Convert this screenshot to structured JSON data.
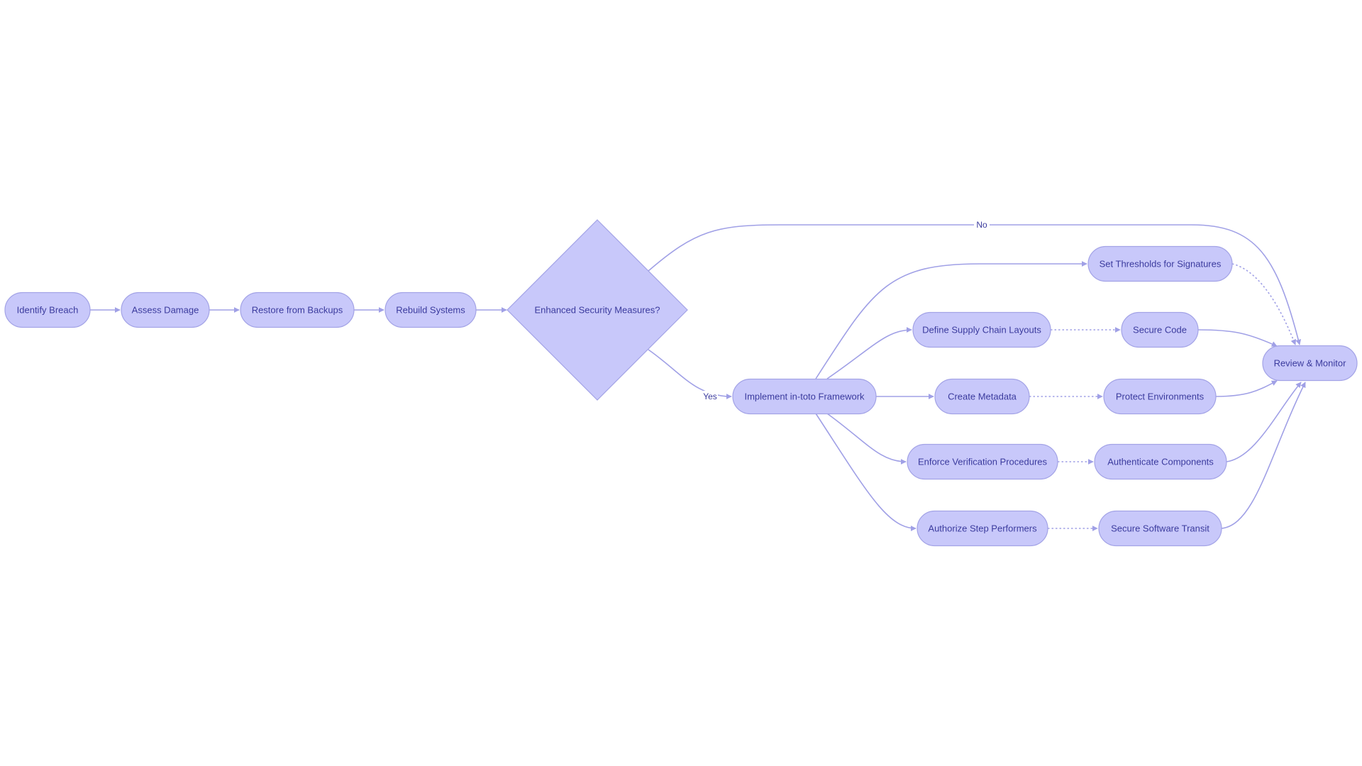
{
  "diagram": {
    "type": "flowchart",
    "direction": "LR",
    "colors": {
      "node_fill": "#c8c8fa",
      "node_stroke": "#a3a3e6",
      "node_text": "#3b3b9e",
      "edge": "#a0a0e6"
    },
    "nodes": [
      {
        "id": "identify",
        "label": "Identify Breach",
        "shape": "stadium"
      },
      {
        "id": "assess",
        "label": "Assess Damage",
        "shape": "stadium"
      },
      {
        "id": "restore",
        "label": "Restore from Backups",
        "shape": "stadium"
      },
      {
        "id": "rebuild",
        "label": "Rebuild Systems",
        "shape": "stadium"
      },
      {
        "id": "decision",
        "label": "Enhanced Security Measures?",
        "shape": "diamond"
      },
      {
        "id": "implement",
        "label": "Implement in-toto Framework",
        "shape": "stadium"
      },
      {
        "id": "thresholds",
        "label": "Set Thresholds for Signatures",
        "shape": "stadium"
      },
      {
        "id": "define",
        "label": "Define Supply Chain Layouts",
        "shape": "stadium"
      },
      {
        "id": "metadata",
        "label": "Create Metadata",
        "shape": "stadium"
      },
      {
        "id": "enforce",
        "label": "Enforce Verification Procedures",
        "shape": "stadium"
      },
      {
        "id": "authorize",
        "label": "Authorize Step Performers",
        "shape": "stadium"
      },
      {
        "id": "securecode",
        "label": "Secure Code",
        "shape": "stadium"
      },
      {
        "id": "protect",
        "label": "Protect Environments",
        "shape": "stadium"
      },
      {
        "id": "authenticate",
        "label": "Authenticate Components",
        "shape": "stadium"
      },
      {
        "id": "transit",
        "label": "Secure Software Transit",
        "shape": "stadium"
      },
      {
        "id": "review",
        "label": "Review & Monitor",
        "shape": "stadium"
      }
    ],
    "edges": [
      {
        "from": "identify",
        "to": "assess",
        "style": "solid",
        "label": ""
      },
      {
        "from": "assess",
        "to": "restore",
        "style": "solid",
        "label": ""
      },
      {
        "from": "restore",
        "to": "rebuild",
        "style": "solid",
        "label": ""
      },
      {
        "from": "rebuild",
        "to": "decision",
        "style": "solid",
        "label": ""
      },
      {
        "from": "decision",
        "to": "implement",
        "style": "solid",
        "label": "Yes"
      },
      {
        "from": "decision",
        "to": "review",
        "style": "solid",
        "label": "No"
      },
      {
        "from": "implement",
        "to": "thresholds",
        "style": "solid",
        "label": ""
      },
      {
        "from": "implement",
        "to": "define",
        "style": "solid",
        "label": ""
      },
      {
        "from": "implement",
        "to": "metadata",
        "style": "solid",
        "label": ""
      },
      {
        "from": "implement",
        "to": "enforce",
        "style": "solid",
        "label": ""
      },
      {
        "from": "implement",
        "to": "authorize",
        "style": "solid",
        "label": ""
      },
      {
        "from": "define",
        "to": "securecode",
        "style": "dotted",
        "label": ""
      },
      {
        "from": "metadata",
        "to": "protect",
        "style": "dotted",
        "label": ""
      },
      {
        "from": "enforce",
        "to": "authenticate",
        "style": "dotted",
        "label": ""
      },
      {
        "from": "authorize",
        "to": "transit",
        "style": "dotted",
        "label": ""
      },
      {
        "from": "thresholds",
        "to": "review",
        "style": "dotted",
        "label": ""
      },
      {
        "from": "securecode",
        "to": "review",
        "style": "solid",
        "label": ""
      },
      {
        "from": "protect",
        "to": "review",
        "style": "solid",
        "label": ""
      },
      {
        "from": "authenticate",
        "to": "review",
        "style": "solid",
        "label": ""
      },
      {
        "from": "transit",
        "to": "review",
        "style": "solid",
        "label": ""
      }
    ]
  }
}
